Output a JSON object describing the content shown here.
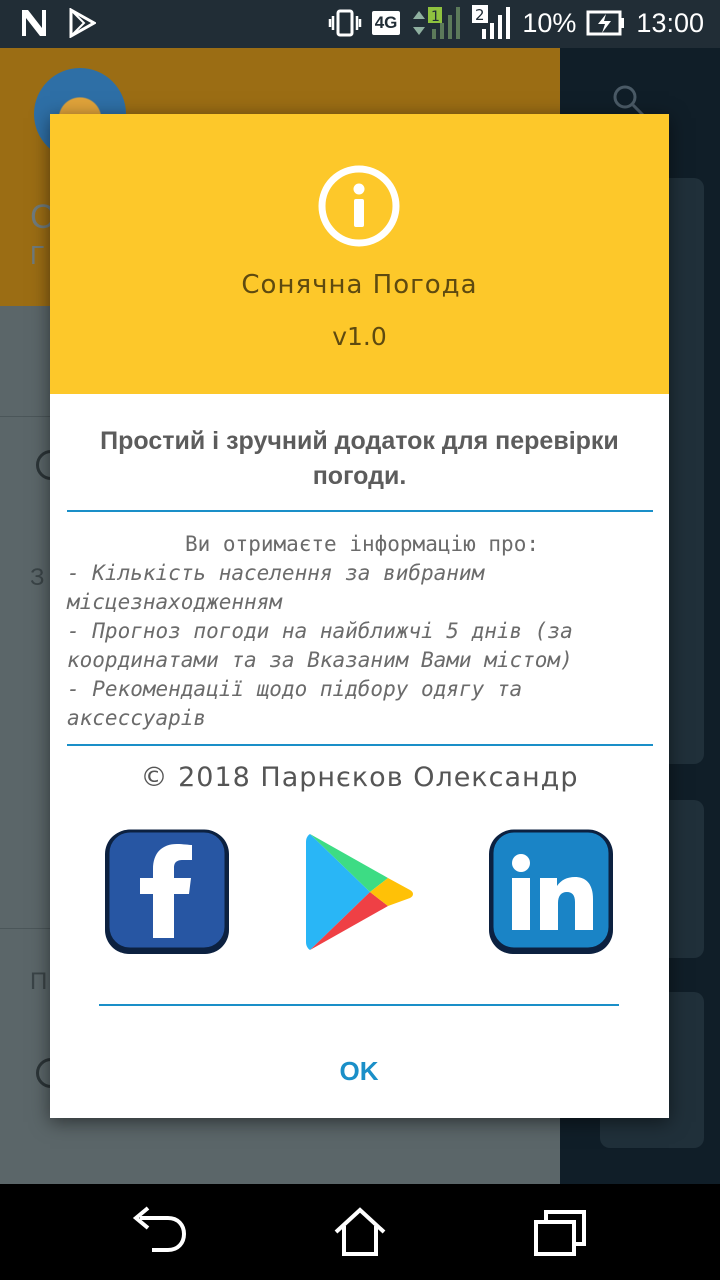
{
  "status_bar": {
    "network": "4G",
    "sim1": "1",
    "sim2": "2",
    "battery": "10%",
    "time": "13:00"
  },
  "background": {
    "header_letters": [
      "С",
      "Г"
    ],
    "drawer_letters": [
      "З",
      "П"
    ]
  },
  "dialog": {
    "icon": "info-icon",
    "title": "Сонячна Погода",
    "version": "v1.0",
    "tagline": "Простий і зручний додаток для перевірки погоди.",
    "intro": "Ви отримаєте інформацію про:",
    "items": [
      "- Кількість населення за вибраним місцезнаходженням",
      "- Прогноз погоди на найближчі 5 днів (за координатами та за Вказаним Вами містом)",
      "- Рекомендації щодо підбору одягу та аксессуарів"
    ],
    "copyright": "© 2018 Парнєков Олександр",
    "links": [
      {
        "icon": "facebook-icon"
      },
      {
        "icon": "google-play-icon"
      },
      {
        "icon": "linkedin-icon"
      }
    ],
    "ok_label": "OK"
  },
  "colors": {
    "header": "#fdc82a",
    "accent": "#1a8fc8",
    "title_text": "#5e4a10"
  },
  "navbar": {
    "icons": [
      "back-icon",
      "home-icon",
      "recents-icon"
    ]
  }
}
